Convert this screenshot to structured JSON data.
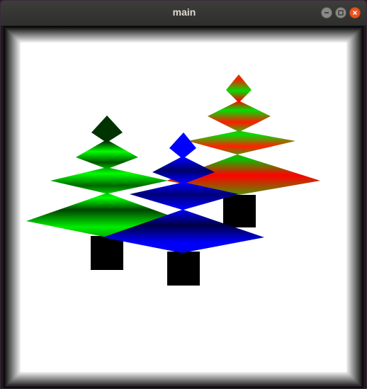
{
  "window": {
    "title": "main",
    "controls": [
      "minimize-icon",
      "maximize-icon",
      "close-icon"
    ],
    "accent_close": "#e95420"
  },
  "scene": {
    "background": "#ffffff",
    "trees": [
      {
        "name": "tree-red-green",
        "colors": [
          "#00ff00",
          "#ff0000"
        ],
        "trunk": "#000000"
      },
      {
        "name": "tree-green",
        "colors": [
          "#00ff00",
          "#003300"
        ],
        "trunk": "#000000"
      },
      {
        "name": "tree-blue",
        "colors": [
          "#0000ff",
          "#000033"
        ],
        "trunk": "#000000"
      }
    ]
  }
}
